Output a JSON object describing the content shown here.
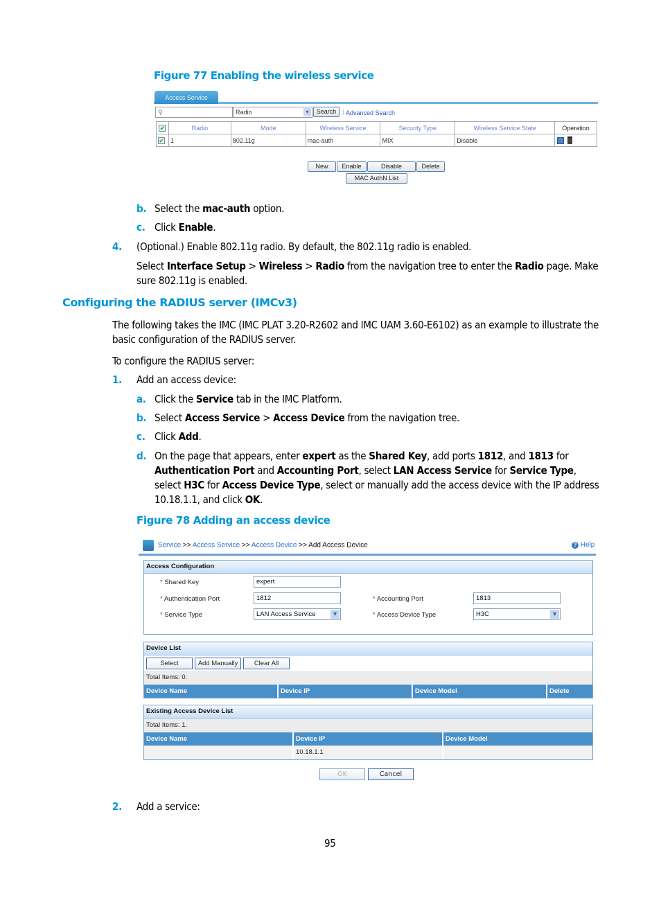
{
  "figure77": {
    "caption": "Figure 77 Enabling the wireless service",
    "tab": "Access Service",
    "search_placeholder": "",
    "search_field": "Radio",
    "search_button": "Search",
    "advanced_search": "Advanced Search",
    "columns": [
      "Radio",
      "Mode",
      "Wireless Service",
      "Security Type",
      "Wireless Service State",
      "Operation"
    ],
    "rows": [
      {
        "checked": true,
        "cells": [
          "1",
          "802.11g",
          "mac-auth",
          "MIX",
          "Disable"
        ],
        "operation_icons": [
          "edit-icon",
          "delete-icon"
        ]
      }
    ],
    "buttons": [
      "New",
      "Enable",
      "Disable",
      "Delete"
    ],
    "button_mac": "MAC AuthN List"
  },
  "steps1": {
    "b_label": "b.",
    "b_text": [
      "Select the ",
      "mac-auth",
      " option."
    ],
    "c_label": "c.",
    "c_text": [
      "Click ",
      "Enable",
      "."
    ],
    "s4_label": "4.",
    "s4_text": "(Optional.) Enable 802.11g radio. By default, the 802.11g radio is enabled.",
    "s4_sub": [
      "Select ",
      "Interface Setup",
      " > ",
      "Wireless",
      " > ",
      "Radio",
      " from the navigation tree to enter the ",
      "Radio",
      " page. Make sure 802.11g is enabled."
    ]
  },
  "section": {
    "heading": "Configuring the RADIUS server (IMCv3)",
    "intro": "The following takes the IMC (IMC PLAT 3.20-R2602 and IMC UAM 3.60-E6102) as an example to illustrate the basic configuration of the RADIUS server.",
    "to_configure": "To configure the RADIUS server:",
    "s1_label": "1.",
    "s1_text": "Add an access device:",
    "a_label": "a.",
    "a_text": [
      "Click the ",
      "Service",
      " tab in the IMC Platform."
    ],
    "b_label": "b.",
    "b_text": [
      "Select ",
      "Access Service",
      " > ",
      "Access Device",
      " from the navigation tree."
    ],
    "c_label": "c.",
    "c_text": [
      "Click ",
      "Add",
      "."
    ],
    "d_label": "d.",
    "d_text": [
      "On the page that appears, enter ",
      "expert",
      " as the ",
      "Shared Key",
      ", add ports ",
      "1812",
      ", and ",
      "1813",
      " for ",
      "Authentication Port",
      " and ",
      "Accounting Port",
      ", select ",
      "LAN Access Service",
      " for ",
      "Service Type",
      ", select ",
      "H3C",
      " for ",
      "Access Device Type",
      ", select or manually add the access device with the IP address 10.18.1.1, and click ",
      "OK",
      "."
    ]
  },
  "figure78": {
    "caption": "Figure 78 Adding an access device",
    "breadcrumb": [
      "Service",
      "Access Service",
      "Access Device",
      "Add Access Device"
    ],
    "breadcrumb_sep": ">>",
    "help": "Help",
    "access_config": {
      "title": "Access Configuration",
      "shared_key_label": "Shared Key",
      "shared_key": "expert",
      "auth_port_label": "Authentication Port",
      "auth_port": "1812",
      "acct_port_label": "Accounting Port",
      "acct_port": "1813",
      "service_type_label": "Service Type",
      "service_type": "LAN Access Service",
      "device_type_label": "Access Device Type",
      "device_type": "H3C"
    },
    "device_list": {
      "title": "Device List",
      "buttons": [
        "Select",
        "Add Manually",
        "Clear All"
      ],
      "total": "Total Items: 0.",
      "columns": [
        "Device Name",
        "Device IP",
        "Device Model",
        "Delete"
      ]
    },
    "existing": {
      "title": "Existing Access Device List",
      "total": "Total Items: 1.",
      "columns": [
        "Device Name",
        "Device IP",
        "Device Model"
      ],
      "rows": [
        [
          "",
          "10.18.1.1",
          ""
        ]
      ]
    },
    "ok": "OK",
    "cancel": "Cancel"
  },
  "step2": {
    "label": "2.",
    "text": "Add a service:"
  },
  "page_number": "95"
}
